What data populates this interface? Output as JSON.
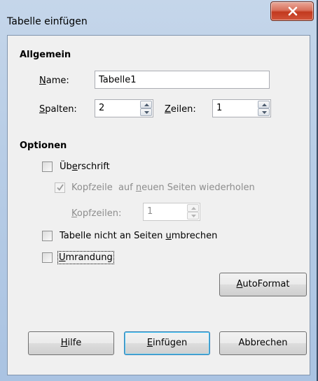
{
  "window": {
    "title": "Tabelle einfügen"
  },
  "general": {
    "heading": "Allgemein",
    "name_label": "Name:",
    "name_value": "Tabelle1",
    "columns_label": "Spalten:",
    "columns_value": "2",
    "rows_label": "Zeilen:",
    "rows_value": "1"
  },
  "options": {
    "heading": "Optionen",
    "heading_label": "Überschrift",
    "heading_checked": false,
    "repeat_label": "Kopfzeile  auf neuen Seiten wiederholen",
    "repeat_checked": true,
    "header_rows_label": "Kopfzeilen:",
    "header_rows_value": "1",
    "no_split_label": "Tabelle nicht an Seiten umbrechen",
    "no_split_checked": false,
    "border_label": "Umrandung",
    "border_checked": false
  },
  "buttons": {
    "autoformat": "AutoFormat",
    "help": "Hilfe",
    "insert": "Einfügen",
    "cancel": "Abbrechen"
  },
  "icons": {
    "close": "close-icon",
    "spin_up": "chevron-up-icon",
    "spin_down": "chevron-down-icon",
    "check": "checkmark-icon"
  },
  "colors": {
    "close_button": "#c2391e",
    "default_button_border": "#3c7fb1",
    "disabled_text": "#8d8d8d"
  }
}
